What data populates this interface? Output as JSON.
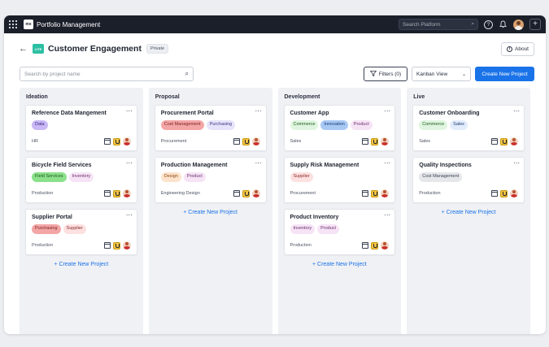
{
  "topbar": {
    "brand_logo": "mx",
    "brand_name": "Portfolio Management",
    "search_placeholder": "Search Platform",
    "icons": [
      "apps-grid-icon",
      "search-icon",
      "help-icon",
      "bell-icon",
      "avatar",
      "plus-icon"
    ]
  },
  "header": {
    "project_logo": "LITE",
    "title": "Customer Engagement",
    "badge": "Private",
    "about_label": "About"
  },
  "toolbar": {
    "search_placeholder": "Search by project name",
    "filters_label": "Filters (0)",
    "view_label": "Kanban View",
    "create_label": "Create New Project"
  },
  "colors": {
    "accent": "#1a73e8",
    "topbar": "#1b1f2a",
    "column_bg": "#f0f1f4"
  },
  "columns": [
    {
      "title": "Ideation",
      "create_label": "+ Create New Project",
      "cards": [
        {
          "title": "Reference Data Mangement",
          "dept": "HR",
          "tags": [
            {
              "label": "Data",
              "bg": "#c9b8f5",
              "fg": "#3d2a80"
            }
          ]
        },
        {
          "title": "Bicycle Field Services",
          "dept": "Production",
          "tags": [
            {
              "label": "Field Services",
              "bg": "#8be08b",
              "fg": "#1d5a1d"
            },
            {
              "label": "Inventory",
              "bg": "#f6e4f6",
              "fg": "#6a2f6a"
            }
          ]
        },
        {
          "title": "Supplier Portal",
          "dept": "Production",
          "tags": [
            {
              "label": "Purchasing",
              "bg": "#f4a6a6",
              "fg": "#7a1f1f"
            },
            {
              "label": "Supplier",
              "bg": "#fde0e0",
              "fg": "#8a2c2c"
            }
          ]
        }
      ]
    },
    {
      "title": "Proposal",
      "create_label": "+ Create New Project",
      "cards": [
        {
          "title": "Procurement Portal",
          "dept": "Procurement",
          "tags": [
            {
              "label": "Cost Management",
              "bg": "#f4a6a6",
              "fg": "#7a1f1f"
            },
            {
              "label": "Purchasing",
              "bg": "#e6e4fb",
              "fg": "#3a3480"
            }
          ]
        },
        {
          "title": "Production Management",
          "dept": "Engineering Design",
          "tags": [
            {
              "label": "Design",
              "bg": "#fde3cc",
              "fg": "#8a4a12"
            },
            {
              "label": "Product",
              "bg": "#f6e4f6",
              "fg": "#6a2f6a"
            }
          ]
        }
      ]
    },
    {
      "title": "Development",
      "create_label": "+ Create New Project",
      "cards": [
        {
          "title": "Customer App",
          "dept": "Sales",
          "tags": [
            {
              "label": "Commerce",
              "bg": "#dff5df",
              "fg": "#1d5a1d"
            },
            {
              "label": "Innovation",
              "bg": "#a9c9f5",
              "fg": "#1a3c70"
            },
            {
              "label": "Product",
              "bg": "#f6e4f6",
              "fg": "#6a2f6a"
            }
          ]
        },
        {
          "title": "Supply Risk Management",
          "dept": "Procurement",
          "tags": [
            {
              "label": "Supplier",
              "bg": "#fde0e0",
              "fg": "#8a2c2c"
            }
          ]
        },
        {
          "title": "Product Inventory",
          "dept": "Production",
          "tags": [
            {
              "label": "Inventory",
              "bg": "#f6e4f6",
              "fg": "#6a2f6a"
            },
            {
              "label": "Product",
              "bg": "#f6e4f6",
              "fg": "#6a2f6a"
            }
          ]
        }
      ]
    },
    {
      "title": "Live",
      "create_label": "+ Create New Project",
      "cards": [
        {
          "title": "Customer Onboarding",
          "dept": "Sales",
          "tags": [
            {
              "label": "Commerce",
              "bg": "#dff5df",
              "fg": "#1d5a1d"
            },
            {
              "label": "Sales",
              "bg": "#e3ecfb",
              "fg": "#1a3c70"
            }
          ]
        },
        {
          "title": "Quality Inspections",
          "dept": "Production",
          "tags": [
            {
              "label": "Cost Management",
              "bg": "#e6e7ea",
              "fg": "#3b4152"
            }
          ]
        }
      ]
    }
  ]
}
